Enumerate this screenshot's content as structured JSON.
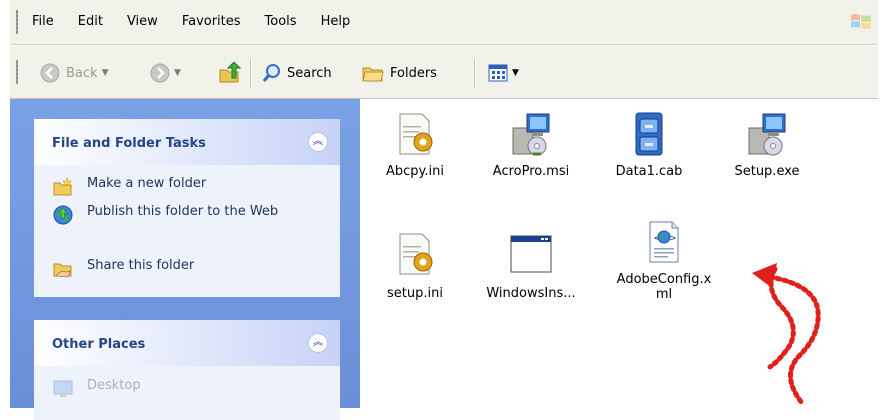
{
  "menubar": {
    "items": [
      "File",
      "Edit",
      "View",
      "Favorites",
      "Tools",
      "Help"
    ]
  },
  "toolbar": {
    "back_label": "Back",
    "search_label": "Search",
    "folders_label": "Folders"
  },
  "sidebar": {
    "file_tasks": {
      "title": "File and Folder Tasks",
      "items": [
        "Make a new folder",
        "Publish this folder to the Web",
        "Share this folder"
      ]
    },
    "other_places": {
      "title": "Other Places",
      "items": [
        "Desktop"
      ]
    }
  },
  "files": [
    {
      "name": "Abcpy.ini",
      "icon": "ini-settings-icon"
    },
    {
      "name": "AcroPro.msi",
      "icon": "installer-icon"
    },
    {
      "name": "Data1.cab",
      "icon": "cabinet-archive-icon"
    },
    {
      "name": "Setup.exe",
      "icon": "installer-icon"
    },
    {
      "name": "setup.ini",
      "icon": "ini-settings-icon"
    },
    {
      "name": "WindowsIns...",
      "icon": "application-window-icon"
    },
    {
      "name": "AdobeConfig.xml",
      "icon": "xml-document-icon"
    }
  ],
  "annotation": {
    "color": "#e0201b",
    "meaning": "red dotted arrow pointing to AdobeConfig.xml"
  }
}
